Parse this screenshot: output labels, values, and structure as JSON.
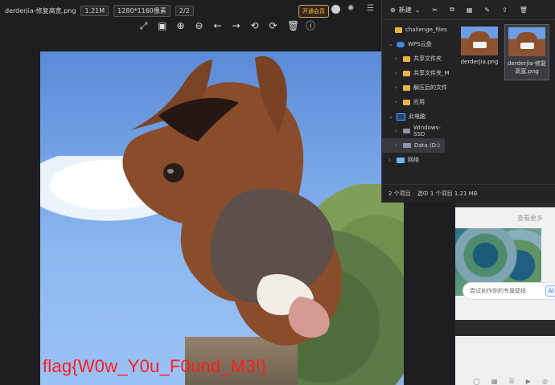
{
  "viewer": {
    "title": "derderjia-修复高宽.png",
    "size": "1.21M",
    "dimensions": "1280*1160像素",
    "page": "2/2",
    "vip_label": "开通会员",
    "toolbar_icons": [
      "expand-icon",
      "fit-icon",
      "zoom-in-icon",
      "zoom-out-icon",
      "arrow-left-icon",
      "arrow-right-icon",
      "rotate-left-icon",
      "rotate-right-icon",
      "delete-icon",
      "info-icon"
    ],
    "image": {
      "flag_text": "flag{W0w_Y0u_F0und_M3!}"
    }
  },
  "explorer": {
    "new_label": "新建",
    "toolbar_icons": [
      "cut-icon",
      "copy-icon",
      "paste-icon",
      "rename-icon",
      "share-icon",
      "delete-icon"
    ],
    "nav": [
      {
        "label": "challenge_files",
        "type": "folder"
      },
      {
        "label": "WPS云盘",
        "type": "cloud"
      },
      {
        "label": "共享文件夹",
        "type": "folder"
      },
      {
        "label": "共享文件夹_M",
        "type": "folder"
      },
      {
        "label": "解压后的文件",
        "type": "folder"
      },
      {
        "label": "应用",
        "type": "folder"
      },
      {
        "label": "此电脑",
        "type": "pc"
      },
      {
        "label": "Windows-SSD",
        "type": "drive"
      },
      {
        "label": "Data (D:)",
        "type": "drive"
      },
      {
        "label": "网络",
        "type": "network"
      }
    ],
    "files": [
      {
        "name": "derderjia.png"
      },
      {
        "name": "derderjia-修复高宽.png"
      }
    ],
    "status_count": "2 个项目",
    "status_selected": "选中 1 个项目 1.21 MB"
  },
  "side": {
    "more_label": "查看更多",
    "ai_text": "尝试创作你的专属壁纸",
    "ai_badge": "AI"
  }
}
